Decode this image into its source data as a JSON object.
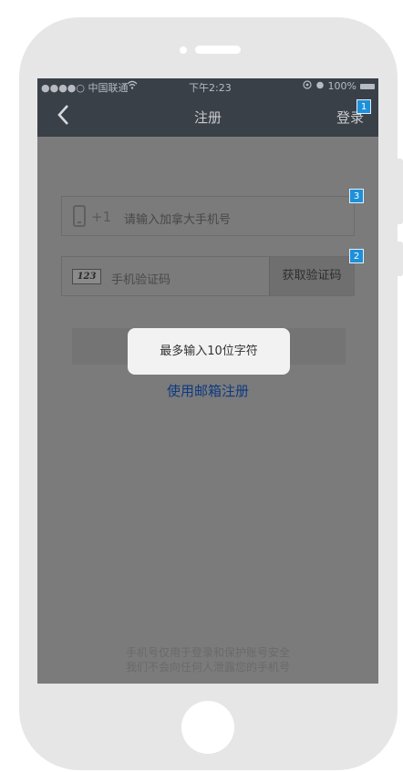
{
  "status_bar": {
    "carrier": "●●●●○ 中国联通",
    "wifi_icon": "wifi-icon",
    "time": "下午2:23",
    "battery_percent": "100%"
  },
  "navbar": {
    "back_icon": "chevron-left-icon",
    "title": "注册",
    "login_label": "登录"
  },
  "form": {
    "phone": {
      "country_code": "+1",
      "placeholder": "请输入加拿大手机号"
    },
    "verification": {
      "placeholder": "手机验证码",
      "code_icon_text": "123",
      "get_code_label": "获取验证码"
    },
    "email_register_label": "使用邮箱注册"
  },
  "toast": {
    "message": "最多输入10位字符"
  },
  "footer": {
    "line1": "手机号仅用于登录和保护账号安全",
    "line2": "我们不会向任何人泄露您的手机号"
  },
  "annotations": {
    "badge_1": "1",
    "badge_2": "2",
    "badge_3": "3"
  },
  "colors": {
    "navbar": "#3a4048",
    "overlay": "#7b7b7b",
    "link": "#0d3a80",
    "badge": "#1e90d8"
  }
}
